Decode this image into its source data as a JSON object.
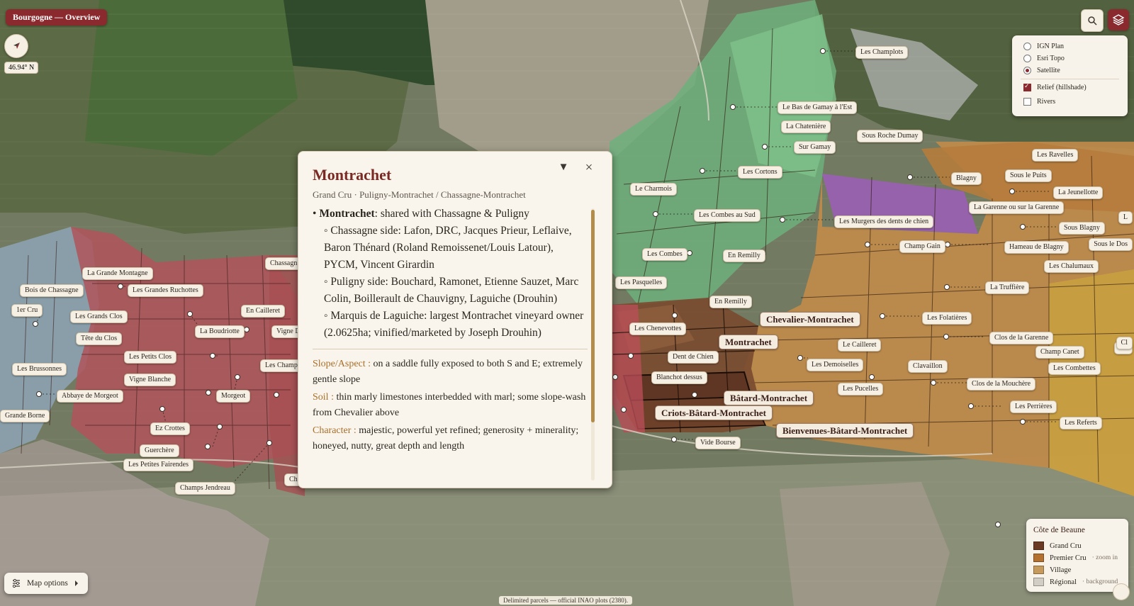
{
  "header": {
    "title": "Bourgogne — Overview"
  },
  "map": {
    "latitude": "46.94° N",
    "attribution": "Delimited parcels — official INAO plots (2380)."
  },
  "icons": {
    "compass": "compass-arrow-icon",
    "search": "search-icon",
    "layers": "layers-icon",
    "collapse": "triangle-down-icon",
    "close": "close-icon",
    "options": "sliders-icon",
    "options_arrow": "chevron-right-icon"
  },
  "colors": {
    "accent": "#8b2a2e",
    "grand_cru": "#6a3a22",
    "premier_cru": "#b3702e",
    "village": "#c69a5c",
    "regional": "#d3cec5",
    "slope_key": "#a86f2a"
  },
  "layers": {
    "base": [
      {
        "label": "IGN Plan",
        "selected": false
      },
      {
        "label": "Esri Topo",
        "selected": false
      },
      {
        "label": "Satellite",
        "selected": true
      }
    ],
    "overlays": [
      {
        "label": "Relief (hillshade)",
        "checked": true
      },
      {
        "label": "Rivers",
        "checked": false
      }
    ]
  },
  "popup": {
    "title": "Montrachet",
    "subtitle": "Grand Cru · Puligny-Montrachet / Chassagne-Montrachet",
    "close": "×",
    "collapse": "▼",
    "bullet_name": "Montrachet",
    "bullet_text": ": shared with Chassagne & Puligny",
    "sub_items": [
      "◦ Chassagne side: Lafon, DRC, Jacques Prieur, Leflaive, Baron Thénard (Roland Remoissenet/Louis Latour), PYCM, Vincent Girardin",
      "◦ Puligny side: Bouchard, Ramonet, Etienne Sauzet, Marc Colin, Boillerault de Chauvigny, Laguiche (Drouhin)",
      "◦ Marquis de Laguiche: largest Montrachet vineyard owner (2.0625ha; vinified/marketed by Joseph Drouhin)"
    ],
    "facts": [
      {
        "key": "Slope/Aspect :",
        "value": " on a saddle fully exposed to both S and E; extremely gentle slope"
      },
      {
        "key": "Soil :",
        "value": " thin marly limestones interbedded with marl; some slope-wash from Chevalier above"
      },
      {
        "key": "Character :",
        "value": " majestic, powerful yet refined; generosity + minerality; honeyed, nutty, great depth and length"
      }
    ]
  },
  "legend": {
    "title": "Côte de Beaune",
    "items": [
      {
        "label": "Grand Cru",
        "note": ""
      },
      {
        "label": "Premier Cru",
        "note": "· zoom in"
      },
      {
        "label": "Village",
        "note": ""
      },
      {
        "label": "Régional",
        "note": "· background"
      }
    ]
  },
  "map_options": {
    "label": "Map options"
  },
  "grand_cru_labels": [
    "Chevalier-Montrachet",
    "Montrachet",
    "Bâtard-Montrachet",
    "Criots-Bâtard-Montrachet",
    "Bienvenues-Bâtard-Montrachet"
  ],
  "climat_labels": [
    "Les Champlots",
    "Le Bas de Gamay à l'Est",
    "La Chatenière",
    "Sous Roche Dumay",
    "Sur Gamay",
    "Les Cortons",
    "Le Charmois",
    "Les Combes au Sud",
    "Les Combes",
    "En Remilly",
    "Les Pasquelles",
    "Les Murgers des dents de chien",
    "Blagny",
    "Les Ravelles",
    "Sous le Puits",
    "La Jeunellotte",
    "La Garenne ou sur la Garenne",
    "Sous Blagny",
    "Champ Gain",
    "Hameau de Blagny",
    "Sous le Dos",
    "Les Chalumaux",
    "La Truffière",
    "En Remilly",
    "Les Folatières",
    "Les Chenevottes",
    "Le Cailleret",
    "Clos de la Garenne",
    "Champ Canet",
    "Les Combettes",
    "Dent de Chien",
    "Les Demoiselles",
    "Clavaillon",
    "Blanchot dessus",
    "Les Pucelles",
    "Clos de la Mouchère",
    "Les Perrières",
    "Les Referts",
    "Vide Bourse",
    "Ch",
    "La Grande Montagne",
    "Bois de Chassagne",
    "Les Grandes Ruchottes",
    "1er Cru",
    "Les Grands Clos",
    "En Cailleret",
    "Chassagn",
    "Tête du Clos",
    "La Boudriotte",
    "Vigne D",
    "Les Petits Clos",
    "Les Champ",
    "Les Brussonnes",
    "Vigne Blanche",
    "Abbaye de Morgeot",
    "Morgeot",
    "Grande Borne",
    "Ez Crottes",
    "Guerchère",
    "Les Petites Fairendes",
    "Champs Jendreau",
    "Ch",
    "Cl",
    "L"
  ]
}
